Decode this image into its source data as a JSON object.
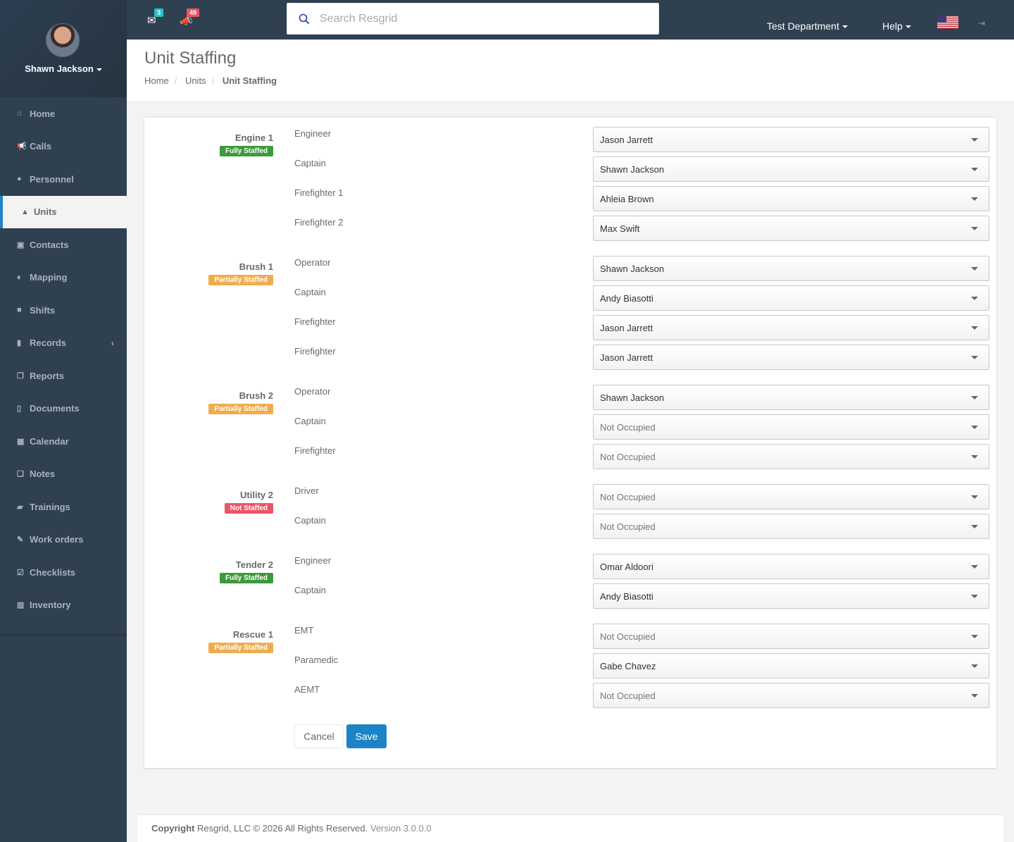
{
  "user": {
    "name": "Shawn Jackson"
  },
  "nav": [
    {
      "label": "Home",
      "icon": "home-icon",
      "glyph": "⌂"
    },
    {
      "label": "Calls",
      "icon": "bullhorn-icon",
      "glyph": "📢"
    },
    {
      "label": "Personnel",
      "icon": "user-icon",
      "glyph": "●"
    },
    {
      "label": "Units",
      "icon": "road-icon",
      "glyph": "▲"
    },
    {
      "label": "Contacts",
      "icon": "address-book-icon",
      "glyph": "▣"
    },
    {
      "label": "Mapping",
      "icon": "map-marker-icon",
      "glyph": "♦"
    },
    {
      "label": "Shifts",
      "icon": "briefcase-icon",
      "glyph": "■"
    },
    {
      "label": "Records",
      "icon": "file-icon",
      "glyph": "▮"
    },
    {
      "label": "Reports",
      "icon": "copy-icon",
      "glyph": "❐"
    },
    {
      "label": "Documents",
      "icon": "file-doc-icon",
      "glyph": "▯"
    },
    {
      "label": "Calendar",
      "icon": "calendar-icon",
      "glyph": "▦"
    },
    {
      "label": "Notes",
      "icon": "notes-icon",
      "glyph": "❏"
    },
    {
      "label": "Trainings",
      "icon": "book-icon",
      "glyph": "▰"
    },
    {
      "label": "Work orders",
      "icon": "wrench-icon",
      "glyph": "✎"
    },
    {
      "label": "Checklists",
      "icon": "check-square-icon",
      "glyph": "☑"
    },
    {
      "label": "Inventory",
      "icon": "barcode-icon",
      "glyph": "▥"
    }
  ],
  "topbar": {
    "messages_count": "3",
    "calls_count": "49",
    "search_placeholder": "Search Resgrid",
    "department": "Test Department",
    "help": "Help"
  },
  "colors": {
    "sidebar": "#2f4050",
    "accent": "#1c84c6",
    "success": "#3c9a3c",
    "warning": "#f0ad4e",
    "danger": "#ed5565",
    "msg_badge": "#23c6c8",
    "call_badge": "#ed5565"
  },
  "page": {
    "title": "Unit Staffing",
    "breadcrumbs": [
      "Home",
      "Units",
      "Unit Staffing"
    ]
  },
  "units": [
    {
      "name": "Engine 1",
      "status": "Fully Staffed",
      "status_color": "#3c9a3c",
      "roles": [
        {
          "role": "Engineer",
          "person": "Jason Jarrett"
        },
        {
          "role": "Captain",
          "person": "Shawn Jackson"
        },
        {
          "role": "Firefighter 1",
          "person": "Ahleia Brown"
        },
        {
          "role": "Firefighter 2",
          "person": "Max Swift"
        }
      ]
    },
    {
      "name": "Brush 1",
      "status": "Partially Staffed",
      "status_color": "#f0ad4e",
      "roles": [
        {
          "role": "Operator",
          "person": "Shawn Jackson"
        },
        {
          "role": "Captain",
          "person": "Andy Biasotti"
        },
        {
          "role": "Firefighter",
          "person": "Jason Jarrett"
        },
        {
          "role": "Firefighter",
          "person": "Jason Jarrett"
        }
      ]
    },
    {
      "name": "Brush 2",
      "status": "Partially Staffed",
      "status_color": "#f0ad4e",
      "roles": [
        {
          "role": "Operator",
          "person": "Shawn Jackson"
        },
        {
          "role": "Captain",
          "person": "Not Occupied"
        },
        {
          "role": "Firefighter",
          "person": "Not Occupied"
        }
      ]
    },
    {
      "name": "Utility 2",
      "status": "Not Staffed",
      "status_color": "#ed5565",
      "roles": [
        {
          "role": "Driver",
          "person": "Not Occupied"
        },
        {
          "role": "Captain",
          "person": "Not Occupied"
        }
      ]
    },
    {
      "name": "Tender 2",
      "status": "Fully Staffed",
      "status_color": "#3c9a3c",
      "roles": [
        {
          "role": "Engineer",
          "person": "Omar Aldoori"
        },
        {
          "role": "Captain",
          "person": "Andy Biasotti"
        }
      ]
    },
    {
      "name": "Rescue 1",
      "status": "Partially Staffed",
      "status_color": "#f0ad4e",
      "roles": [
        {
          "role": "EMT",
          "person": "Not Occupied"
        },
        {
          "role": "Paramedic",
          "person": "Gabe Chavez"
        },
        {
          "role": "AEMT",
          "person": "Not Occupied"
        }
      ]
    }
  ],
  "buttons": {
    "cancel": "Cancel",
    "save": "Save"
  },
  "footer": {
    "copyright_label": "Copyright",
    "text": " Resgrid, LLC © 2026 All Rights Reserved.",
    "version": " Version 3.0.0.0"
  }
}
